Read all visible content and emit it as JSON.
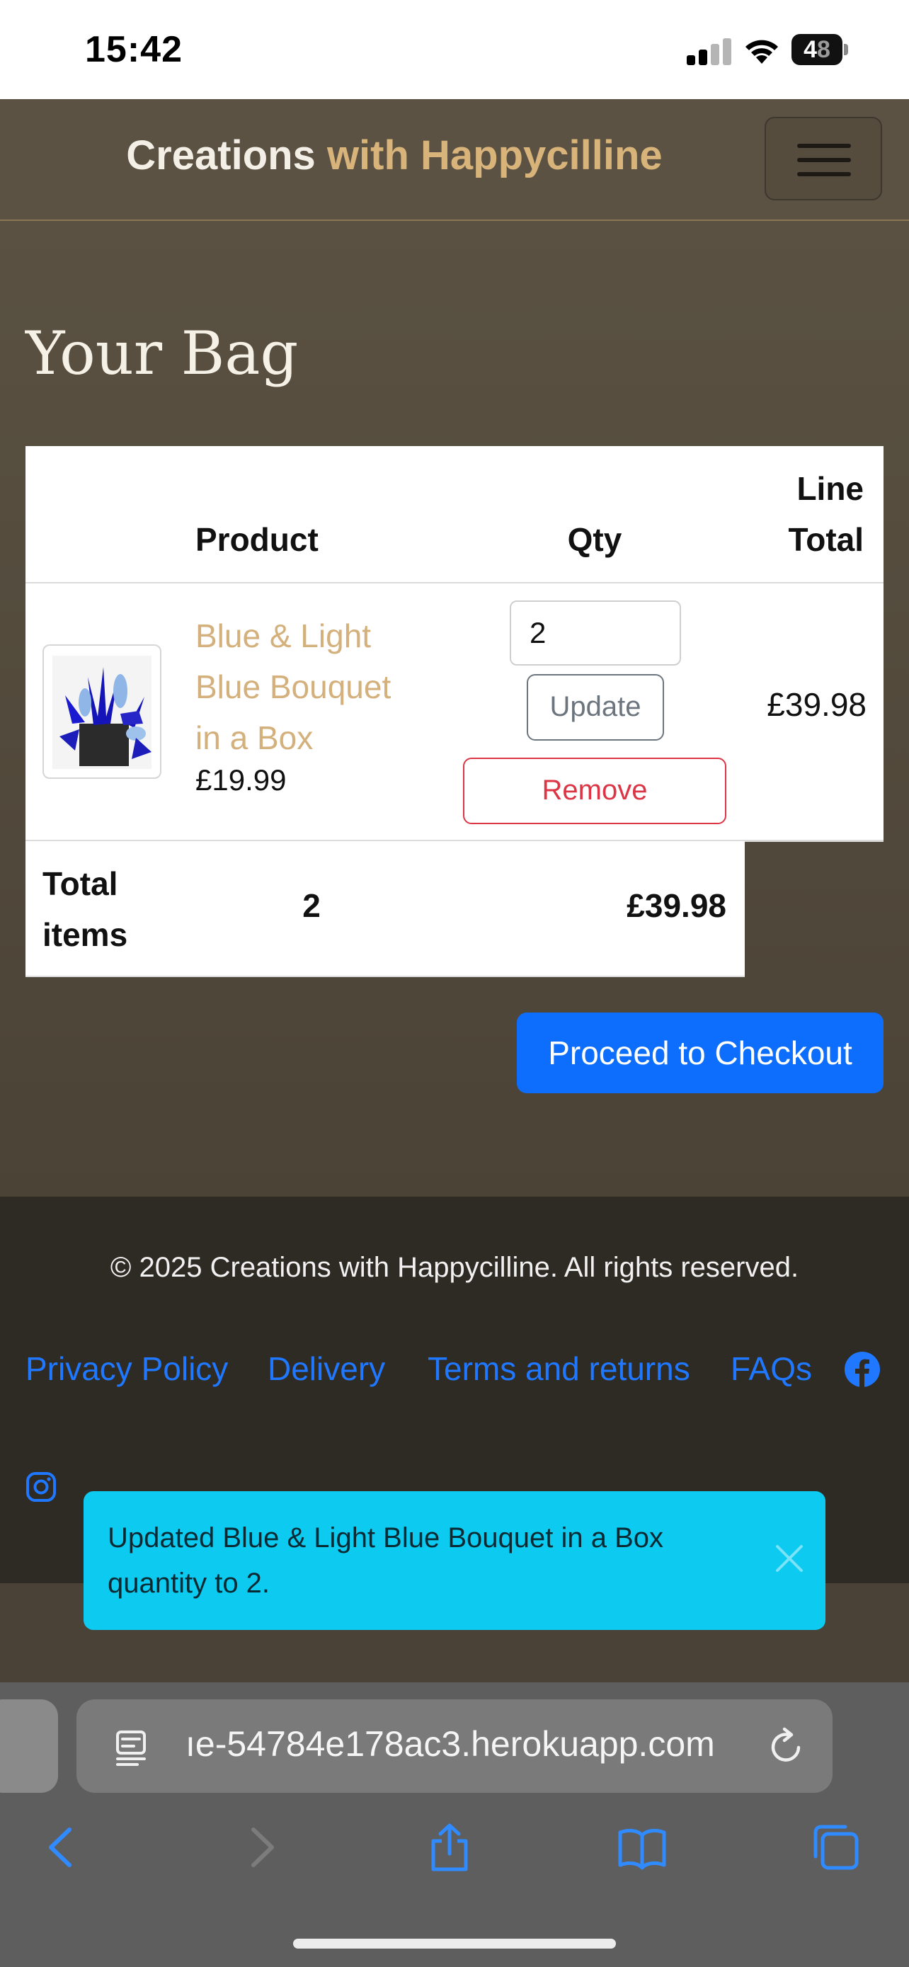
{
  "status_bar": {
    "time": "15:42",
    "battery_level": "48"
  },
  "navbar": {
    "brand_main": "Creations",
    "brand_accent": "with Happycilline",
    "menu_icon": "hamburger-icon"
  },
  "page": {
    "title": "Your Bag"
  },
  "table": {
    "headers": {
      "product": "Product",
      "qty": "Qty",
      "line_total": "Line Total"
    },
    "rows": [
      {
        "name": "Blue & Light Blue Bouquet in a Box",
        "price": "£19.99",
        "qty": "2",
        "update_label": "Update",
        "remove_label": "Remove",
        "line_total": "£39.98"
      }
    ],
    "summary": {
      "label": "Total items",
      "count": "2",
      "total": "£39.98"
    }
  },
  "checkout": {
    "label": "Proceed to Checkout"
  },
  "footer": {
    "copyright": "© 2025 Creations with Happycilline. All rights reserved.",
    "links": [
      "Privacy Policy",
      "Delivery",
      "Terms and returns",
      "FAQs"
    ],
    "social_icons": [
      "facebook-icon",
      "instagram-icon"
    ]
  },
  "toast": {
    "message": "Updated Blue & Light Blue Bouquet in a Box quantity to 2."
  },
  "browser": {
    "url": "ıe-54784e178ac3.herokuapp.com"
  },
  "colors": {
    "accent": "#d8b37a",
    "primary": "#0d6efd",
    "danger": "#dc3545",
    "info": "#0dcaf0",
    "link": "#1f78ff"
  }
}
